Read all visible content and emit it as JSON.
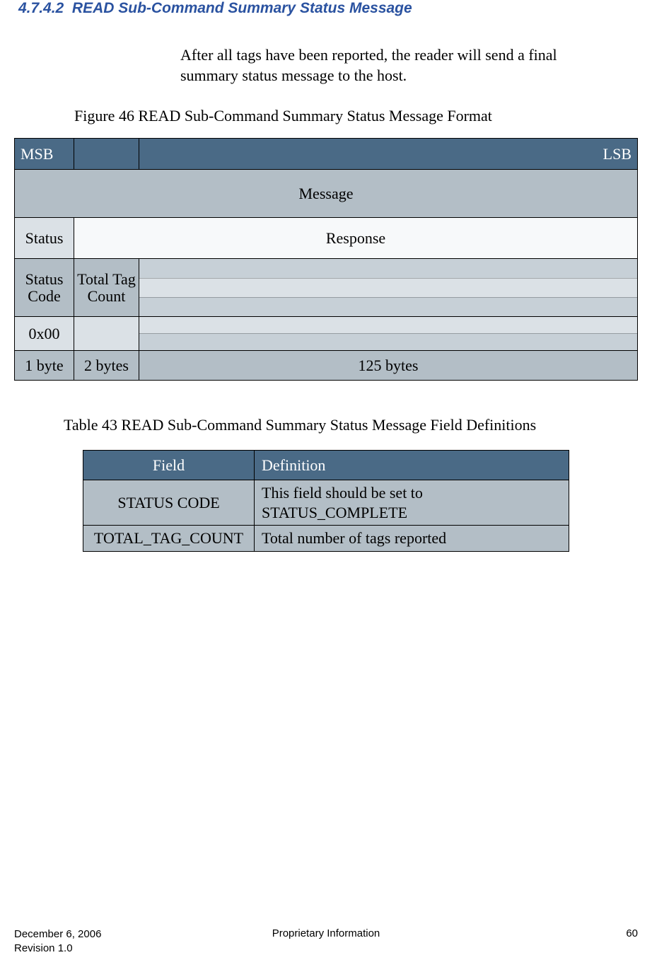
{
  "section": {
    "number": "4.7.4.2",
    "title": "READ Sub-Command Summary Status Message"
  },
  "intro": "After all tags have been reported, the reader will send a final summary status message to the host.",
  "figure": {
    "caption": "Figure 46 READ Sub-Command Summary Status Message Format",
    "msb": "MSB",
    "lsb": "LSB",
    "message": "Message",
    "status": "Status",
    "response": "Response",
    "status_code": "Status Code",
    "total_tag_count": "Total Tag Count",
    "value_0": "0x00",
    "size_0": "1 byte",
    "size_1": "2 bytes",
    "size_2": "125 bytes"
  },
  "table": {
    "caption": "Table 43 READ Sub-Command Summary Status Message Field Definitions",
    "head_field": "Field",
    "head_def": "Definition",
    "rows": [
      {
        "field": "STATUS CODE",
        "def": "This field should be set to STATUS_COMPLETE"
      },
      {
        "field": "TOTAL_TAG_COUNT",
        "def": "Total number of tags reported"
      }
    ]
  },
  "footer": {
    "date": "December 6, 2006",
    "revision": "Revision 1.0",
    "center": "Proprietary Information",
    "page": "60"
  }
}
